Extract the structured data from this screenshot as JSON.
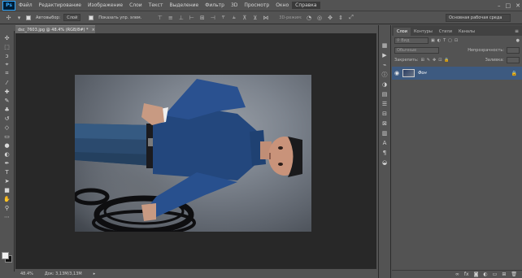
{
  "app": {
    "logo": "Ps"
  },
  "menu": [
    "Файл",
    "Редактирование",
    "Изображение",
    "Слои",
    "Текст",
    "Выделение",
    "Фильтр",
    "3D",
    "Просмотр",
    "Окно",
    "Справка"
  ],
  "window_controls": [
    "–",
    "□",
    "✕"
  ],
  "options": {
    "auto_select_label": "Автовыбор:",
    "auto_select_value": "Слой",
    "show_controls_label": "Показать упр. элем.",
    "mode_3d_label": "3D-режим:",
    "workspace": "Основная рабочая среда"
  },
  "document": {
    "tab_title": "dsc_7603.jpg @ 48.4% (RGB/8#) *",
    "close": "×"
  },
  "status": {
    "zoom": "48.4%",
    "doc_size": "Док: 3,13M/3,13M"
  },
  "layers_panel": {
    "tabs": [
      "Слои",
      "Контуры",
      "Стили",
      "Каналы"
    ],
    "kind_filter": "Вид",
    "blend_mode": "Обычные",
    "opacity_label": "Непрозрачность:",
    "lock_label": "Закрепить:",
    "fill_label": "Заливка:",
    "layer_name": "Фон"
  },
  "colors": {
    "ui_bg": "#535353",
    "canvas_bg": "#282828",
    "selected_layer": "#3d5a80",
    "accent": "#31a8ff"
  }
}
